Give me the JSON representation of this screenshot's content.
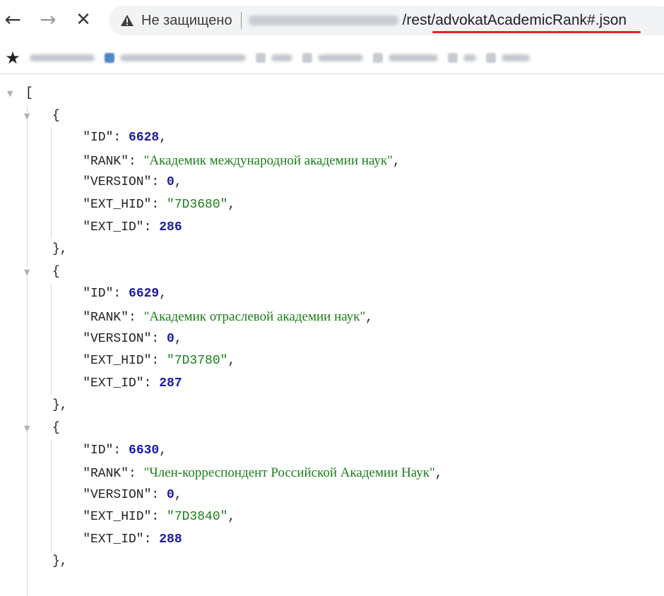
{
  "toolbar": {
    "back_icon": "back-arrow-icon",
    "forward_icon": "forward-arrow-icon",
    "stop_icon": "close-icon",
    "back_glyph": "←",
    "forward_glyph": "→",
    "stop_glyph": "✕",
    "security_label": "Не защищено",
    "url_path": "/rest/advokatAcademicRank#.json",
    "underline_color": "#e0251f"
  },
  "bookmarks": {
    "star_glyph": "★"
  },
  "json": {
    "open_array": "[",
    "objects": [
      {
        "id": "6628",
        "rank": "Академик международной академии наук",
        "version": "0",
        "ext_hid": "7D3680",
        "ext_id": "286"
      },
      {
        "id": "6629",
        "rank": "Академик отраслевой академии наук",
        "version": "0",
        "ext_hid": "7D3780",
        "ext_id": "287"
      },
      {
        "id": "6630",
        "rank": "Член-корреспондент Российской Академии Наук",
        "version": "0",
        "ext_hid": "7D3840",
        "ext_id": "288"
      }
    ],
    "keys": {
      "id": "\"ID\"",
      "rank": "\"RANK\"",
      "version": "\"VERSION\"",
      "ext_hid": "\"EXT_HID\"",
      "ext_id": "\"EXT_ID\""
    },
    "colors": {
      "number": "#1a1aa6",
      "string": "#1a7f1a"
    }
  }
}
